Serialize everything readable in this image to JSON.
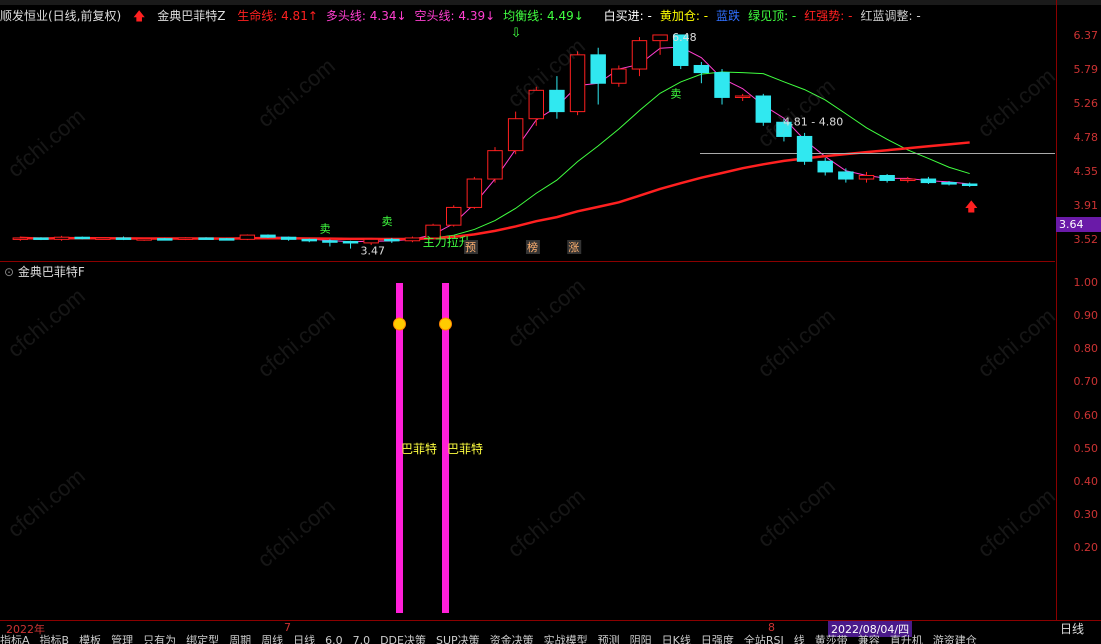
{
  "header": {
    "stock": "顺发恒业(日线,前复权)",
    "indicator_name": "金典巴菲特Z",
    "lines": [
      {
        "label": "生命线:",
        "value": "4.81",
        "arrow": "↑",
        "color": "#ff2020"
      },
      {
        "label": "多头线:",
        "value": "4.34",
        "arrow": "↓",
        "color": "#ff3fd0"
      },
      {
        "label": "空头线:",
        "value": "4.39",
        "arrow": "↓",
        "color": "#ff3fd0"
      },
      {
        "label": "均衡线:",
        "value": "4.49",
        "arrow": "↓",
        "color": "#40ff40"
      }
    ],
    "signals": [
      {
        "label": "白买进:",
        "value": "-",
        "color": "#ffffff"
      },
      {
        "label": "黄加仓:",
        "value": "-",
        "color": "#ffff00"
      },
      {
        "label": "蓝跌",
        "value": "",
        "color": "#3070ff"
      },
      {
        "label": "绿见顶:",
        "value": "-",
        "color": "#40ff40"
      },
      {
        "label": "红强势:",
        "value": "-",
        "color": "#ff2020"
      },
      {
        "label": "红蓝调整:",
        "value": "-",
        "color": "#cccccc"
      }
    ]
  },
  "price_axis": [
    "6.37",
    "5.79",
    "5.26",
    "4.78",
    "4.35",
    "3.91",
    "3.52"
  ],
  "current_price": "3.64",
  "indicator_axis": [
    "1.00",
    "0.90",
    "0.80",
    "0.70",
    "0.60",
    "0.50",
    "0.40",
    "0.30",
    "0.20"
  ],
  "annotations": {
    "high": "6.48",
    "low": "3.47",
    "range": "4.81 - 4.80",
    "rise_label": "主力拉升",
    "sell_label": "卖",
    "markers": [
      "预",
      "榜",
      "涨"
    ]
  },
  "sub": {
    "title": "金典巴菲特F",
    "bar_label": "巴菲特"
  },
  "x_labels": {
    "year": "2022年",
    "m7": "7",
    "m8": "8",
    "date": "2022/08/04/四"
  },
  "period": "日线",
  "tabs": [
    "指标A",
    "指标B",
    "模板",
    "管理",
    "只有为",
    "绑定型",
    "周期",
    "周线",
    "日线",
    "6.0",
    "7.0",
    "DDE决策",
    "SUP决策",
    "资金决策",
    "实战模型",
    "预测",
    "阴阳",
    "日K线",
    "日强度",
    "全站RSI",
    "线",
    "黄莎带",
    "兼容",
    "直升机",
    "游资建仓"
  ],
  "colors": {
    "up": "#ff2020",
    "down": "#30e8f0",
    "life": "#ff2020",
    "bull": "#ff3fd0",
    "bear": "#ff3fd0",
    "balance": "#40ff40",
    "magenta": "#ff1fd8"
  },
  "chart_data": {
    "type": "candlestick",
    "candles": [
      [
        3.6,
        3.62,
        3.58,
        3.64
      ],
      [
        3.62,
        3.6,
        3.59,
        3.63
      ],
      [
        3.6,
        3.63,
        3.58,
        3.65
      ],
      [
        3.63,
        3.61,
        3.6,
        3.64
      ],
      [
        3.61,
        3.62,
        3.6,
        3.63
      ],
      [
        3.62,
        3.6,
        3.59,
        3.64
      ],
      [
        3.6,
        3.61,
        3.58,
        3.62
      ],
      [
        3.61,
        3.6,
        3.59,
        3.62
      ],
      [
        3.6,
        3.62,
        3.59,
        3.63
      ],
      [
        3.62,
        3.61,
        3.6,
        3.63
      ],
      [
        3.61,
        3.6,
        3.59,
        3.62
      ],
      [
        3.6,
        3.66,
        3.59,
        3.67
      ],
      [
        3.66,
        3.63,
        3.62,
        3.67
      ],
      [
        3.63,
        3.6,
        3.58,
        3.64
      ],
      [
        3.6,
        3.58,
        3.56,
        3.61
      ],
      [
        3.58,
        3.57,
        3.5,
        3.6
      ],
      [
        3.57,
        3.55,
        3.47,
        3.58
      ],
      [
        3.55,
        3.6,
        3.52,
        3.62
      ],
      [
        3.6,
        3.58,
        3.55,
        3.62
      ],
      [
        3.58,
        3.62,
        3.56,
        3.64
      ],
      [
        3.62,
        3.8,
        3.6,
        3.82
      ],
      [
        3.8,
        4.05,
        3.78,
        4.08
      ],
      [
        4.05,
        4.45,
        4.03,
        4.48
      ],
      [
        4.45,
        4.85,
        4.4,
        4.9
      ],
      [
        4.85,
        5.3,
        4.8,
        5.4
      ],
      [
        5.3,
        5.7,
        5.2,
        5.75
      ],
      [
        5.7,
        5.4,
        5.3,
        5.9
      ],
      [
        5.4,
        6.2,
        5.35,
        6.25
      ],
      [
        6.2,
        5.8,
        5.5,
        6.3
      ],
      [
        5.8,
        6.0,
        5.75,
        6.05
      ],
      [
        6.0,
        6.4,
        5.9,
        6.45
      ],
      [
        6.4,
        6.48,
        6.2,
        6.48
      ],
      [
        6.48,
        6.05,
        6.0,
        6.48
      ],
      [
        6.05,
        5.95,
        5.8,
        6.1
      ],
      [
        5.95,
        5.6,
        5.5,
        6.0
      ],
      [
        5.6,
        5.62,
        5.55,
        5.65
      ],
      [
        5.62,
        5.25,
        5.2,
        5.65
      ],
      [
        5.25,
        5.05,
        4.98,
        5.3
      ],
      [
        5.05,
        4.7,
        4.65,
        5.1
      ],
      [
        4.7,
        4.55,
        4.5,
        4.75
      ],
      [
        4.55,
        4.45,
        4.4,
        4.6
      ],
      [
        4.45,
        4.5,
        4.4,
        4.55
      ],
      [
        4.5,
        4.43,
        4.4,
        4.52
      ],
      [
        4.43,
        4.45,
        4.4,
        4.48
      ],
      [
        4.45,
        4.4,
        4.38,
        4.48
      ],
      [
        4.4,
        4.38,
        4.36,
        4.42
      ],
      [
        4.38,
        4.36,
        4.34,
        4.4
      ]
    ],
    "ylim": [
      3.45,
      6.55
    ]
  }
}
